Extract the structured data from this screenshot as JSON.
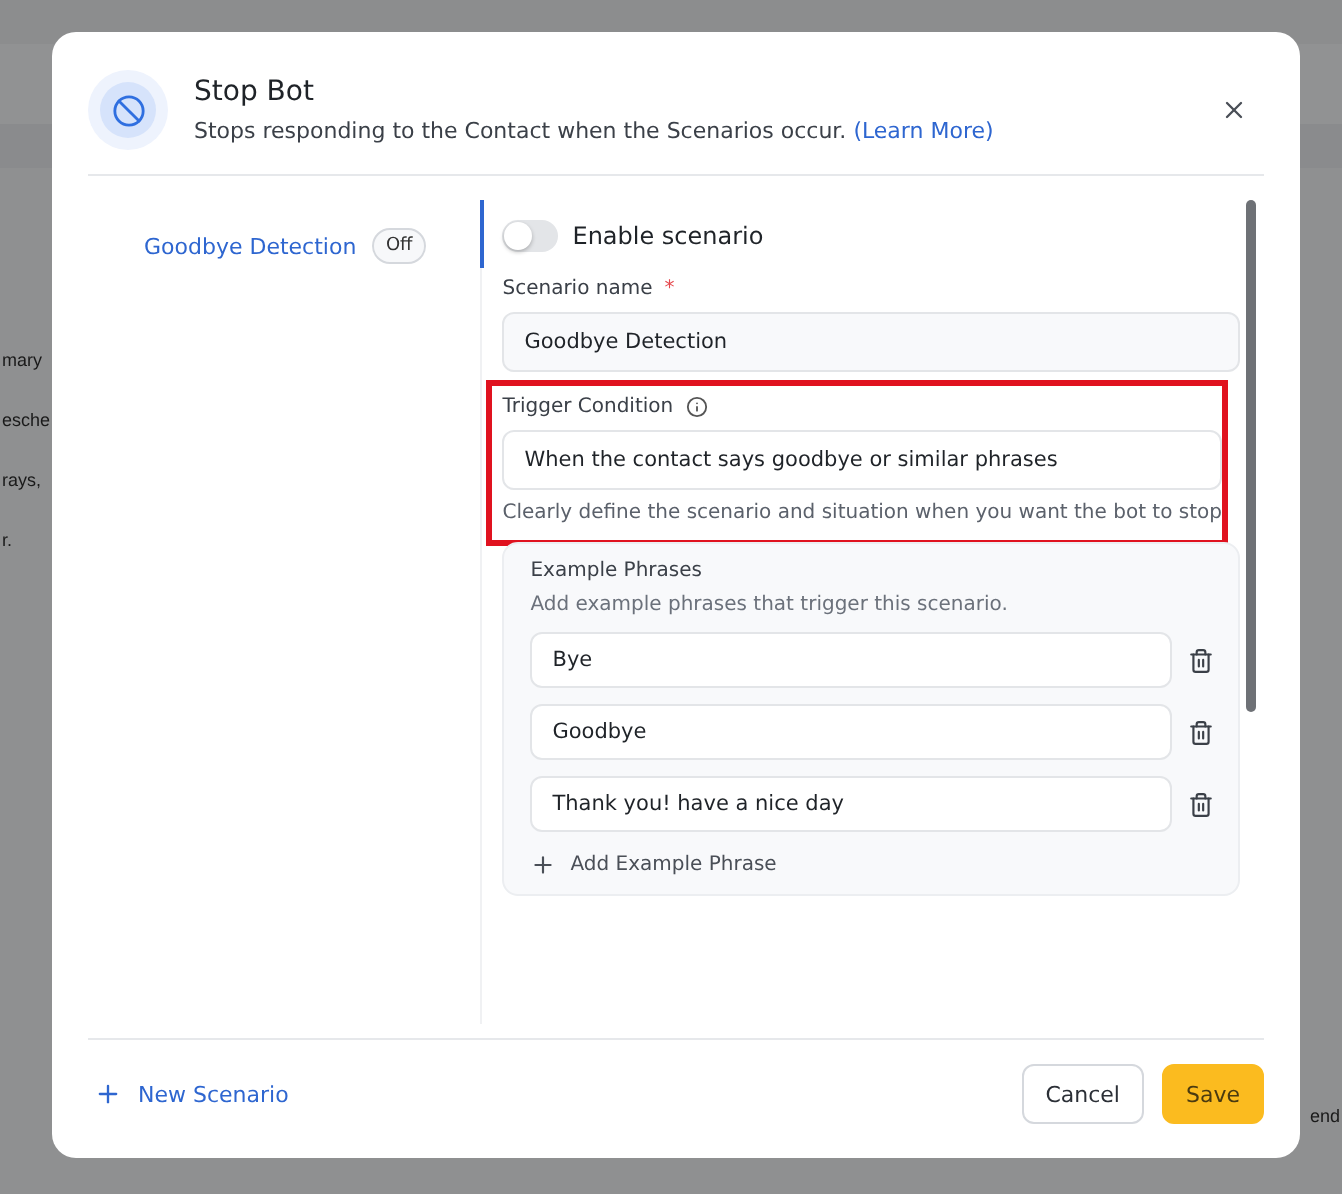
{
  "background": {
    "left_fragments": [
      "mary",
      "esche",
      "rays,",
      "r."
    ],
    "right_fragments": [
      "end"
    ]
  },
  "dialog": {
    "title": "Stop Bot",
    "subtitle": "Stops responding to the Contact when the Scenarios occur.",
    "learn_more": "(Learn More)"
  },
  "sidebar": {
    "items": [
      {
        "label": "Goodbye Detection",
        "status": "Off",
        "selected": true
      }
    ]
  },
  "form": {
    "enable_toggle": {
      "label": "Enable scenario",
      "on": false
    },
    "scenario_name": {
      "label": "Scenario name",
      "required_mark": "*",
      "value": "Goodbye Detection"
    },
    "trigger": {
      "label": "Trigger Condition",
      "value": "When the contact says goodbye or similar phrases",
      "help": "Clearly define the scenario and situation when you want the bot to stop",
      "highlighted": true
    },
    "examples": {
      "title": "Example Phrases",
      "description": "Add example phrases that trigger this scenario.",
      "phrases": [
        "Bye",
        "Goodbye",
        "Thank you! have a nice day"
      ],
      "add_label": "Add Example Phrase"
    }
  },
  "footer": {
    "new_scenario": "New Scenario",
    "cancel": "Cancel",
    "save": "Save"
  }
}
